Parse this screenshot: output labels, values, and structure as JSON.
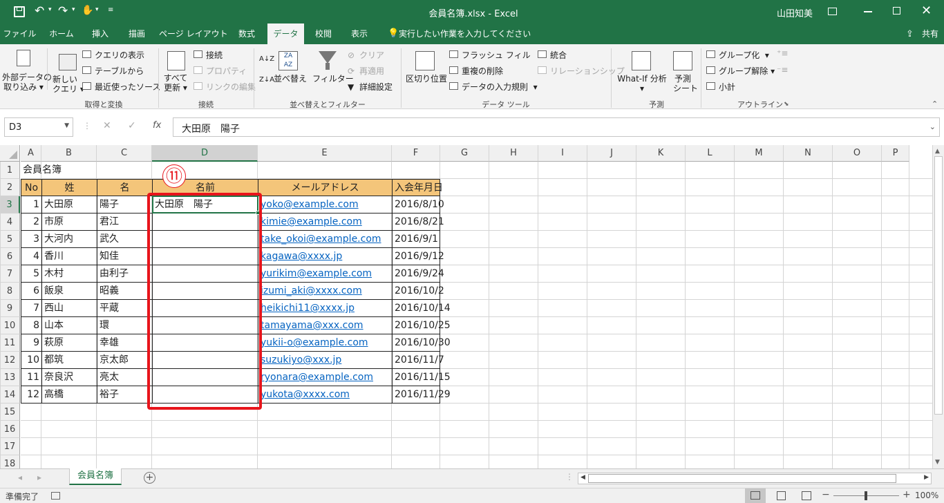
{
  "window": {
    "title": "会員名簿.xlsx  -  Excel",
    "user": "山田知美",
    "share": "共有"
  },
  "tabs": [
    "ファイル",
    "ホーム",
    "挿入",
    "描画",
    "ページ レイアウト",
    "数式",
    "データ",
    "校閲",
    "表示"
  ],
  "tell_me": "実行したい作業を入力してください",
  "ribbon": {
    "get_external": [
      "外部データの",
      "取り込み"
    ],
    "new_query": [
      "新しい",
      "クエリ"
    ],
    "show_queries": "クエリの表示",
    "from_table": "テーブルから",
    "recent_sources": "最近使ったソース",
    "group_get_transform": "取得と変換",
    "refresh_all": [
      "すべて",
      "更新"
    ],
    "connections": "接続",
    "properties": "プロパティ",
    "edit_links": "リンクの編集",
    "group_connections": "接続",
    "sort": "並べ替え",
    "filter": "フィルター",
    "clear": "クリア",
    "reapply": "再適用",
    "advanced": "詳細設定",
    "group_sort_filter": "並べ替えとフィルター",
    "text_to_columns": "区切り位置",
    "flash_fill": "フラッシュ フィル",
    "remove_duplicates": "重複の削除",
    "data_validation": "データの入力規則",
    "consolidate": "統合",
    "relationships": "リレーションシップ",
    "group_data_tools": "データ ツール",
    "what_if": "What-If 分析",
    "forecast_sheet": [
      "予測",
      "シート"
    ],
    "group_forecast": "予測",
    "group": "グループ化",
    "ungroup": "グループ解除",
    "subtotal": "小計",
    "group_outline": "アウトライン"
  },
  "formula_bar": {
    "name_box": "D3",
    "fx": "fx",
    "value": "大田原　陽子"
  },
  "columns": [
    "A",
    "B",
    "C",
    "D",
    "E",
    "F",
    "G",
    "H",
    "I",
    "J",
    "K",
    "L",
    "M",
    "N",
    "O",
    "P"
  ],
  "selected_column": "D",
  "rows": [
    "1",
    "2",
    "3",
    "4",
    "5",
    "6",
    "7",
    "8",
    "9",
    "10",
    "11",
    "12",
    "13",
    "14",
    "15",
    "16",
    "17",
    "18"
  ],
  "selected_row": "3",
  "sheet": {
    "title": "会員名簿",
    "headers": [
      "No",
      "姓",
      "名",
      "名前",
      "メールアドレス",
      "入会年月日"
    ],
    "header_color": "#f4c57a",
    "data": [
      [
        "1",
        "大田原",
        "陽子",
        "大田原　陽子",
        "yoko@example.com",
        "2016/8/10"
      ],
      [
        "2",
        "市原",
        "君江",
        "",
        "kimie@example.com",
        "2016/8/21"
      ],
      [
        "3",
        "大河内",
        "武久",
        "",
        "take_okoi@example.com",
        "2016/9/1"
      ],
      [
        "4",
        "香川",
        "知佳",
        "",
        "kagawa@xxxx.jp",
        "2016/9/12"
      ],
      [
        "5",
        "木村",
        "由利子",
        "",
        "yurikim@example.com",
        "2016/9/24"
      ],
      [
        "6",
        "飯泉",
        "昭義",
        "",
        "izumi_aki@xxxx.com",
        "2016/10/2"
      ],
      [
        "7",
        "西山",
        "平蔵",
        "",
        "heikichi11@xxxx.jp",
        "2016/10/14"
      ],
      [
        "8",
        "山本",
        "環",
        "",
        "tamayama@xxx.com",
        "2016/10/25"
      ],
      [
        "9",
        "萩原",
        "幸雄",
        "",
        "yukii-o@example.com",
        "2016/10/30"
      ],
      [
        "10",
        "都筑",
        "京太郎",
        "",
        "suzukiyo@xxx.jp",
        "2016/11/7"
      ],
      [
        "11",
        "奈良沢",
        "亮太",
        "",
        "ryonara@example.com",
        "2016/11/15"
      ],
      [
        "12",
        "高橋",
        "裕子",
        "",
        "yukota@xxxx.com",
        "2016/11/29"
      ]
    ]
  },
  "callout": {
    "label": "⑪",
    "color": "#e8141b"
  },
  "sheet_tab": "会員名簿",
  "status": "準備完了",
  "zoom": "100%",
  "brand_color": "#217346",
  "link_color": "#0563c1"
}
